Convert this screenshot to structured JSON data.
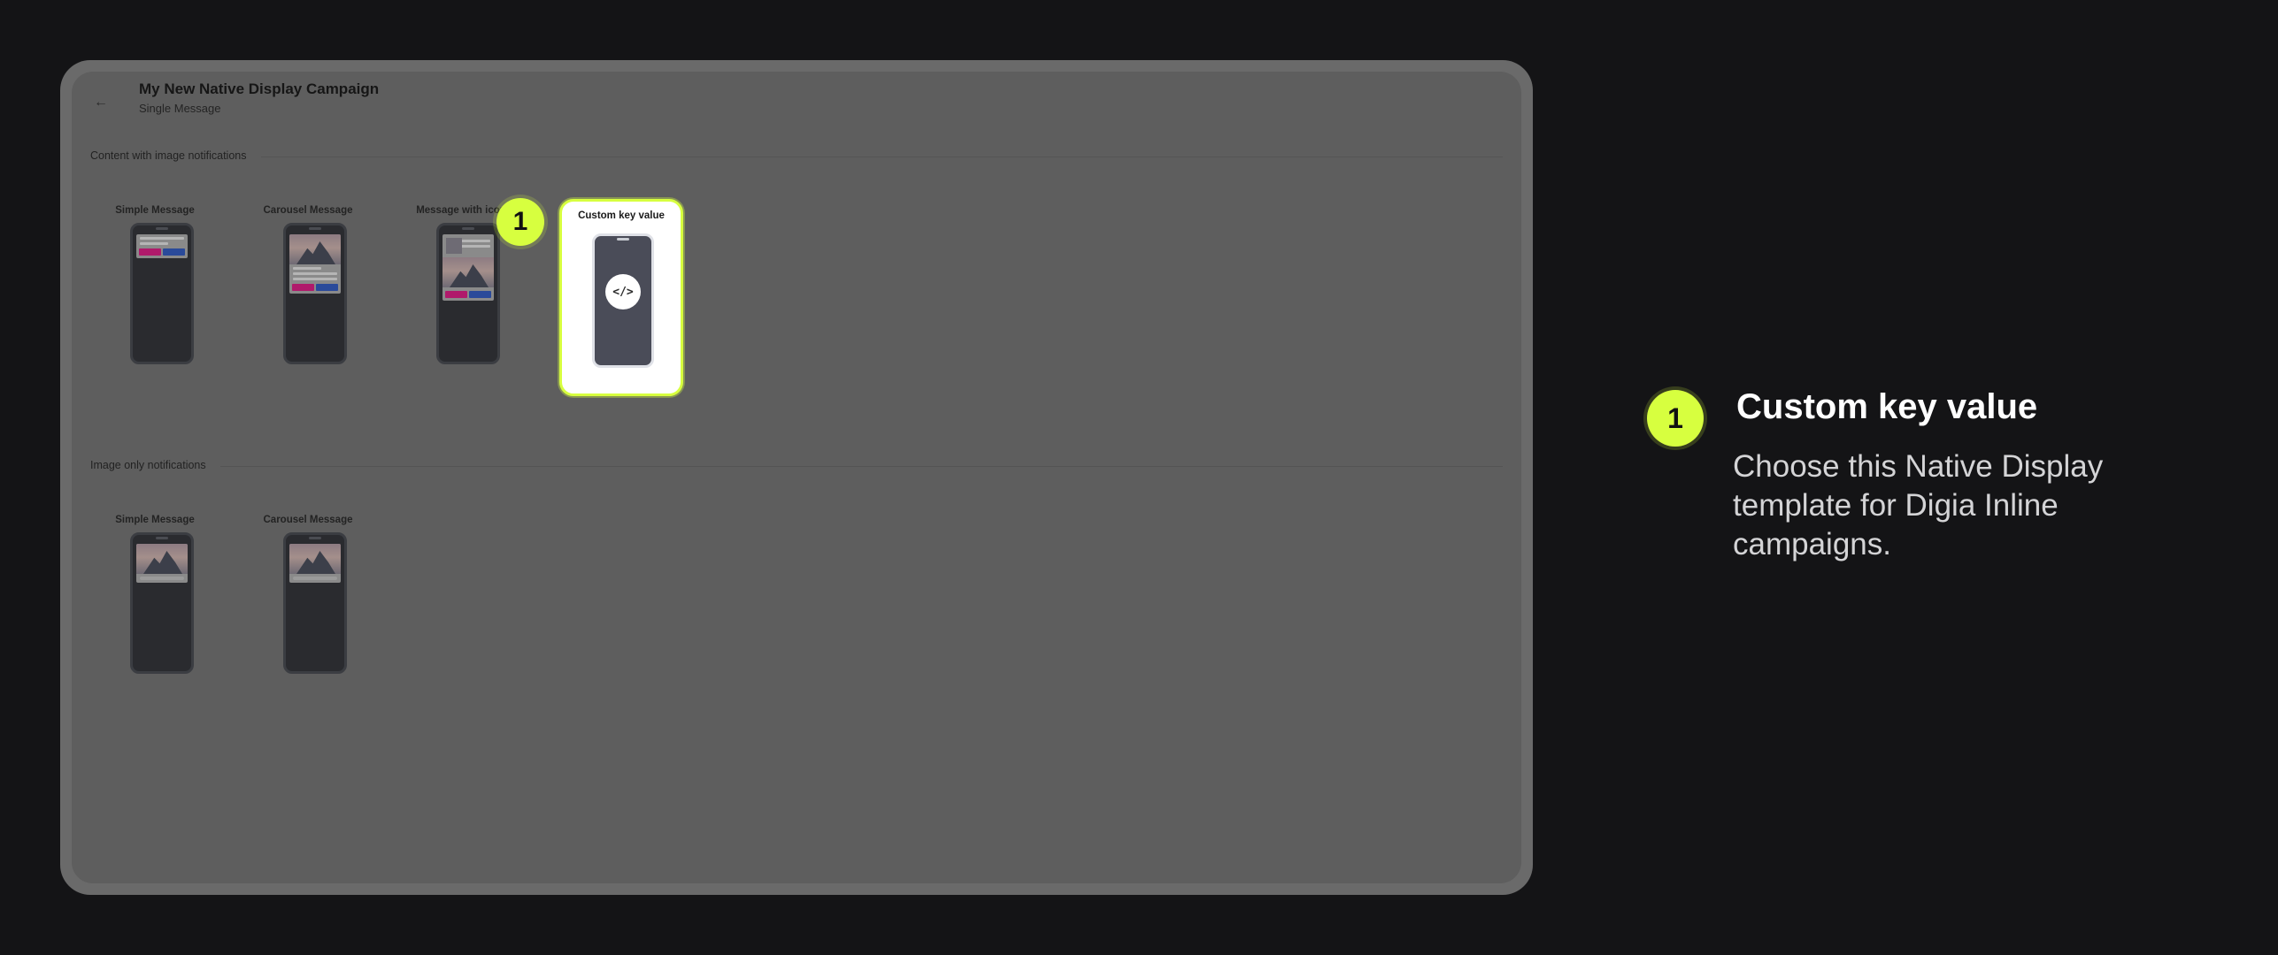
{
  "campaign": {
    "title": "My New Native Display Campaign",
    "subtitle": "Single Message",
    "back_icon": "arrow-left-icon"
  },
  "sections": {
    "content_with_image": {
      "title": "Content with image notifications",
      "templates": [
        "Simple Message",
        "Carousel Message",
        "Message with icon",
        "Custom key value"
      ]
    },
    "image_only": {
      "title": "Image only notifications",
      "templates": [
        "Simple Message",
        "Carousel Message"
      ]
    }
  },
  "custom_template": {
    "code_icon_text": "</>"
  },
  "callout": {
    "number": "1",
    "title": "Custom key value",
    "description": "Choose this Native Display template for Digia Inline campaigns."
  },
  "colors": {
    "background": "#141416",
    "accent": "#d7ff3f",
    "overlay": "#5e5e5e"
  }
}
